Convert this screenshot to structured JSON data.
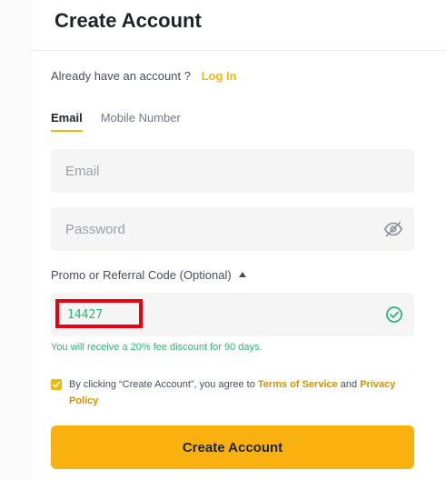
{
  "header": {
    "title": "Create Account"
  },
  "login_prompt": {
    "text": "Already have an account ?",
    "link": "Log In"
  },
  "tabs": [
    {
      "label": "Email",
      "active": true
    },
    {
      "label": "Mobile Number",
      "active": false
    }
  ],
  "email": {
    "placeholder": "Email",
    "value": ""
  },
  "password": {
    "placeholder": "Password",
    "value": "",
    "icon": "eye-off-icon"
  },
  "promo": {
    "label": "Promo or Referral Code (Optional)",
    "value": "14427",
    "status_icon": "check-circle-icon",
    "discount_text": "You will receive a 20% fee discount for 90 days."
  },
  "terms": {
    "checked": true,
    "prefix": "By clicking “Create Account”, you agree to",
    "tos_link": "Terms of Service",
    "and": "and",
    "privacy_link": "Privacy Policy"
  },
  "submit": {
    "label": "Create Account"
  },
  "colors": {
    "accent": "#f0b90b",
    "button": "#f8b10e",
    "success": "#2bb673",
    "highlight": "#e60012"
  }
}
